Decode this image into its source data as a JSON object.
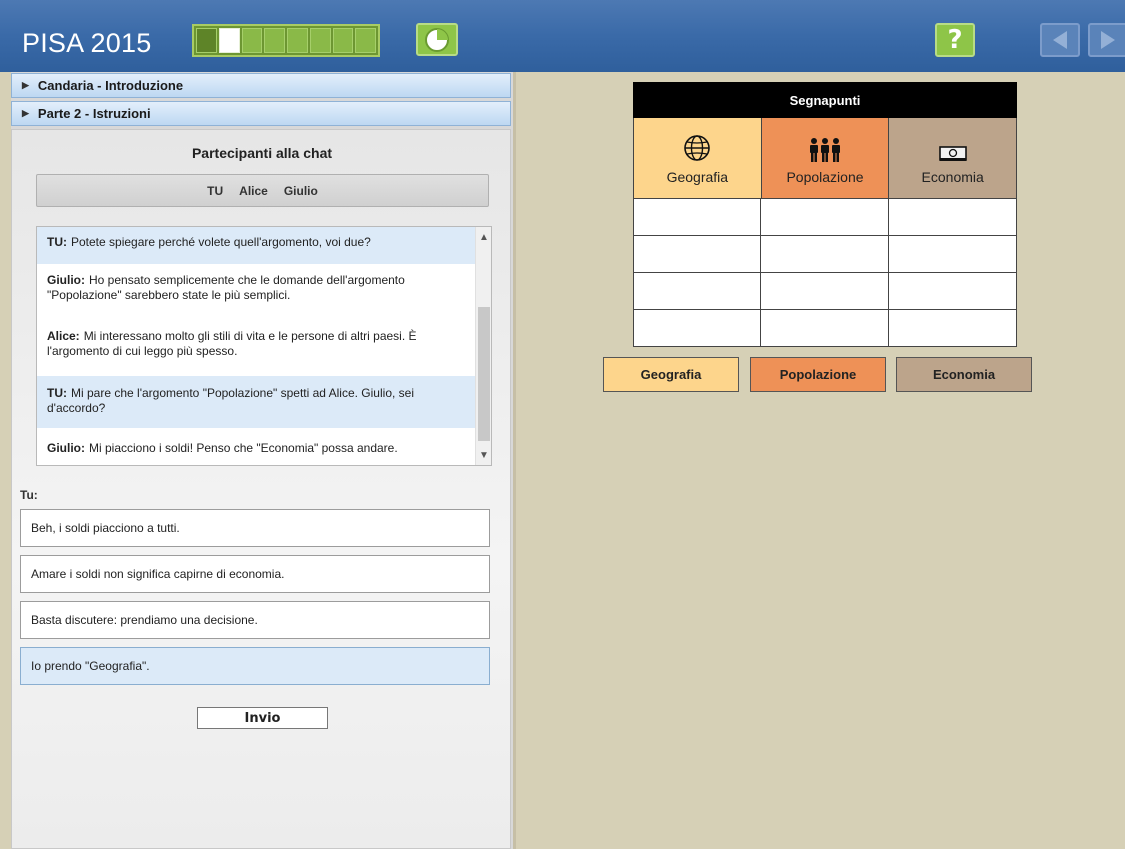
{
  "app": {
    "title": "PISA 2015",
    "help_label": "?"
  },
  "progress": {
    "segments": 8,
    "done": 1,
    "current": 2
  },
  "accordion": [
    {
      "label": "Candaria - Introduzione"
    },
    {
      "label": "Parte 2 - Istruzioni"
    }
  ],
  "chat": {
    "participants_title": "Partecipanti alla chat",
    "participants": [
      "TU",
      "Alice",
      "Giulio"
    ],
    "messages": [
      {
        "speaker": "TU:",
        "text": "Potete spiegare perché volete quell'argomento, voi due?"
      },
      {
        "speaker": "Giulio:",
        "text": "Ho pensato semplicemente che le domande dell'argomento \"Popolazione\" sarebbero state le più semplici."
      },
      {
        "speaker": "Alice:",
        "text": "Mi interessano molto gli stili di vita e le persone di altri paesi. È l'argomento di cui leggo più spesso."
      },
      {
        "speaker": "TU:",
        "text": "Mi pare che l'argomento \"Popolazione\" spetti ad Alice. Giulio, sei d'accordo?"
      },
      {
        "speaker": "Giulio:",
        "text": "Mi piacciono i soldi! Penso che \"Economia\" possa andare."
      }
    ],
    "you_label": "Tu:",
    "options": [
      "Beh, i soldi piacciono a tutti.",
      "Amare i soldi non significa capirne di economia.",
      "Basta discutere: prendiamo una decisione.",
      "Io prendo \"Geografia\"."
    ],
    "selected_option": 3,
    "send_label": "Invio"
  },
  "scoreboard": {
    "title": "Segnapunti",
    "categories": [
      {
        "label": "Geografia",
        "icon": "globe-icon",
        "color": "#fdd58c"
      },
      {
        "label": "Popolazione",
        "icon": "people-icon",
        "color": "#ee9157"
      },
      {
        "label": "Economia",
        "icon": "money-icon",
        "color": "#bca48b"
      }
    ],
    "rows": 4
  },
  "category_buttons": [
    "Geografia",
    "Popolazione",
    "Economia"
  ]
}
